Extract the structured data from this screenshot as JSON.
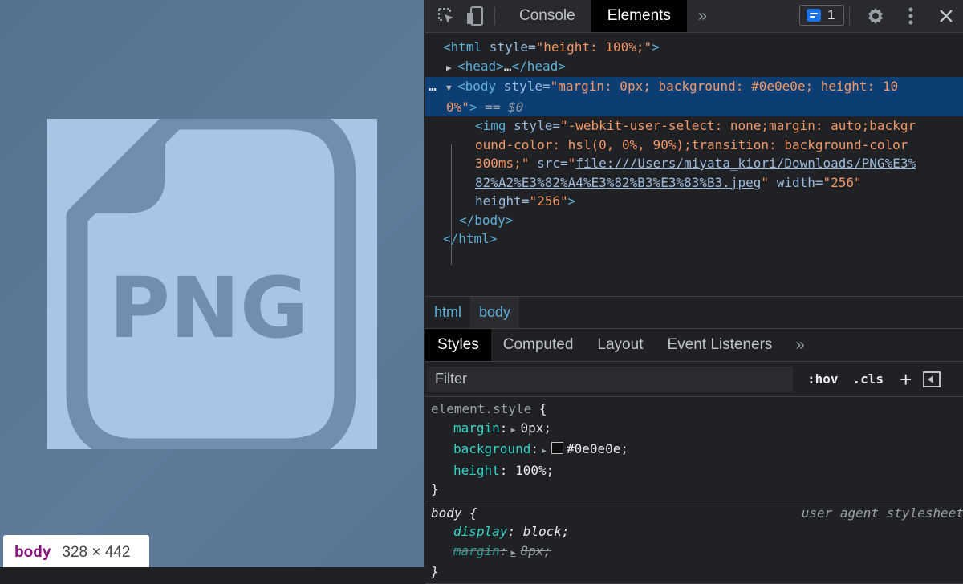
{
  "preview": {
    "image_text": "PNG",
    "tooltip": {
      "tag": "body",
      "dimensions": "328 × 442"
    }
  },
  "toolbar": {
    "tabs": [
      "Console",
      "Elements"
    ],
    "active_tab": "Elements",
    "more": "»",
    "issues_count": "1"
  },
  "dom": {
    "html_open": {
      "tag": "<html",
      "attr": " style=",
      "val": "\"height: 100%;\"",
      "close": ">"
    },
    "head": {
      "open": "<head>",
      "ellipsis": "…",
      "close": "</head>"
    },
    "body_open": {
      "dots": "…",
      "tag": "<body",
      "attr": " style=",
      "val_line1": "\"margin: 0px; background: #0e0e0e; height: 10",
      "val_line2": "0%\"",
      "close": ">",
      "eq": " == $0"
    },
    "img": {
      "tag": "<img",
      "attr_style": " style=",
      "style_line1": "\"-webkit-user-select: none;margin: auto;backgr",
      "style_line2": "ound-color: hsl(0, 0%, 90%);transition: background-color",
      "style_line3": "300ms;\"",
      "attr_src": " src=",
      "q": "\"",
      "src_line1": "file:///Users/miyata_kiori/Downloads/PNG%E3%",
      "src_line2": "82%A2%E3%82%A4%E3%82%B3%E3%83%B3.jpeg",
      "attr_width": " width=",
      "width_val": "\"256\"",
      "attr_height": "height=",
      "height_val": "\"256\"",
      "close": ">"
    },
    "body_close": "</body>",
    "html_close": "</html>"
  },
  "breadcrumbs": [
    "html",
    "body"
  ],
  "styles_tabs": [
    "Styles",
    "Computed",
    "Layout",
    "Event Listeners"
  ],
  "styles_more": "»",
  "filter": {
    "placeholder": "Filter",
    "hov": ":hov",
    "cls": ".cls",
    "add": "+"
  },
  "rules": {
    "element_style": {
      "selector": "element.style",
      "open": " {",
      "props": [
        {
          "name": "margin",
          "value": "0px;"
        },
        {
          "name": "background",
          "value": "#0e0e0e;"
        },
        {
          "name": "height",
          "value": "100%;"
        }
      ],
      "close": "}"
    },
    "body_ua": {
      "selector": "body",
      "open": " {",
      "source": "user agent stylesheet",
      "props": [
        {
          "name": "display",
          "value": "block;"
        },
        {
          "name": "margin",
          "value": "8px;"
        }
      ],
      "close": "}"
    }
  },
  "colors": {
    "preview_bg": "#5a7593",
    "image_bg": "#a7c5e4",
    "icon_fg": "#6f8eb0",
    "selected_row": "#0d3e73",
    "tag_color": "#5db0d7",
    "value_color": "#f29766",
    "prop_color": "#35d4c7"
  }
}
